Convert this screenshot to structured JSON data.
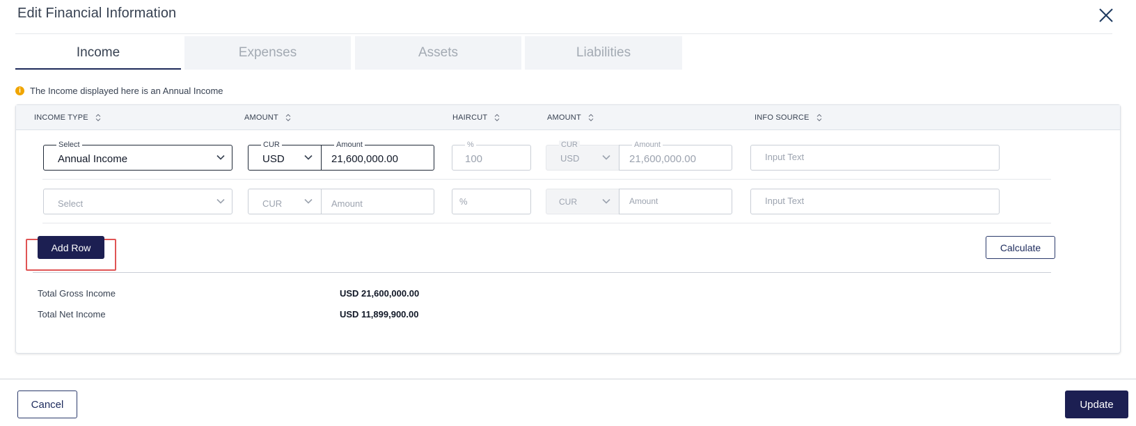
{
  "dialog": {
    "title": "Edit Financial Information",
    "close_icon": "close-icon"
  },
  "tabs": [
    {
      "label": "Income",
      "active": true
    },
    {
      "label": "Expenses",
      "active": false
    },
    {
      "label": "Assets",
      "active": false
    },
    {
      "label": "Liabilities",
      "active": false
    }
  ],
  "info": {
    "icon": "info-icon",
    "text": "The Income displayed here is an Annual Income"
  },
  "table": {
    "headers": [
      "INCOME TYPE",
      "AMOUNT",
      "HAIRCUT",
      "AMOUNT",
      "INFO SOURCE"
    ],
    "rows": [
      {
        "income_type_label": "Select",
        "income_type_value": "Annual Income",
        "cur_label": "CUR",
        "cur_value": "USD",
        "amount_label": "Amount",
        "amount_value": "21,600,000.00",
        "haircut_label": "%",
        "haircut_value": "100",
        "net_cur_label": "CUR",
        "net_cur_value": "USD",
        "net_amount_label": "Amount",
        "net_amount_value": "21,600,000.00",
        "info_source_placeholder": "Input Text"
      },
      {
        "income_type_placeholder": "Select",
        "cur_placeholder": "CUR",
        "amount_placeholder": "Amount",
        "haircut_placeholder": "%",
        "net_cur_placeholder": "CUR",
        "net_amount_placeholder": "Amount",
        "info_source_placeholder": "Input Text"
      }
    ]
  },
  "actions": {
    "add_row": "Add Row",
    "calculate": "Calculate",
    "cancel": "Cancel",
    "update": "Update"
  },
  "totals": {
    "gross_label": "Total Gross Income",
    "gross_value": "USD 21,600,000.00",
    "net_label": "Total Net Income",
    "net_value": "USD 11,899,900.00"
  },
  "colors": {
    "primary": "#1c1f52",
    "highlight": "#e05454",
    "info": "#f0a500"
  }
}
